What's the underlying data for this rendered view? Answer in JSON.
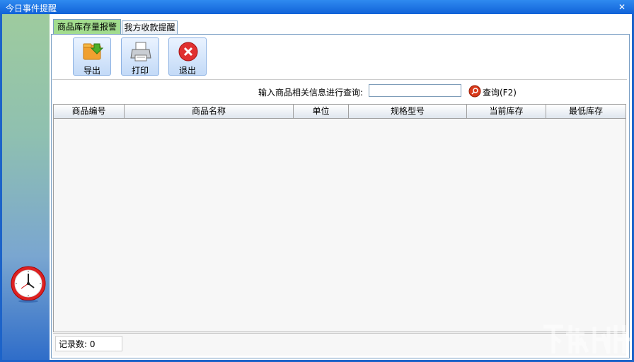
{
  "window": {
    "title": "今日事件提醒",
    "close_icon": "close-icon"
  },
  "tabs": [
    {
      "label": "商品库存量报警",
      "active": true
    },
    {
      "label": "我方收款提醒",
      "active": false
    }
  ],
  "toolbar": {
    "export_label": "导出",
    "print_label": "打印",
    "exit_label": "退出"
  },
  "query": {
    "label": "输入商品相关信息进行查询:",
    "value": "",
    "button_label": "查询(F2)"
  },
  "table": {
    "columns": [
      "商品编号",
      "商品名称",
      "单位",
      "规格型号",
      "当前库存",
      "最低库存"
    ],
    "rows": []
  },
  "status": {
    "record_count_label": "记录数: 0"
  },
  "colors": {
    "title_bar": "#1c63c9",
    "active_tab": "#a2dc8e",
    "exit_icon": "#e03030"
  }
}
